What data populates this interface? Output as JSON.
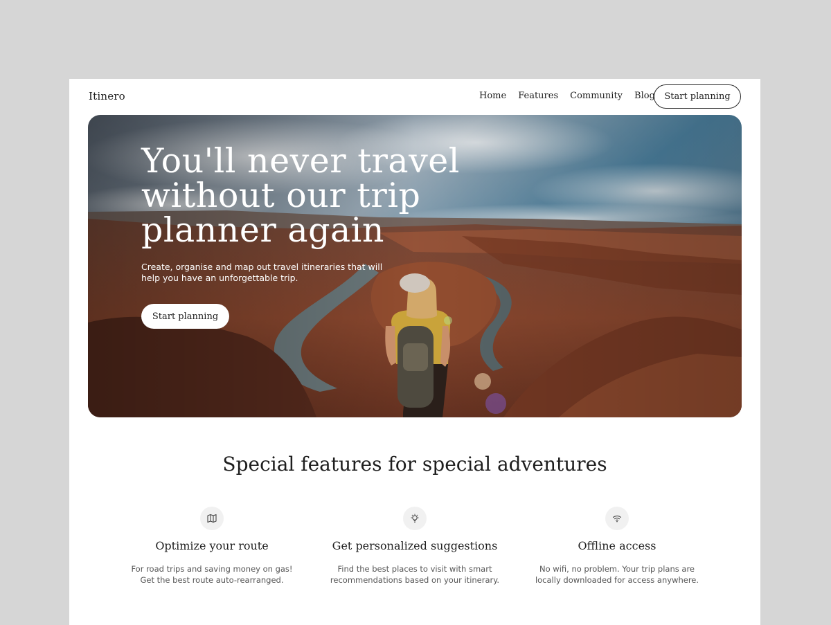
{
  "nav": {
    "logo": "Itinero",
    "links": [
      "Home",
      "Features",
      "Community",
      "Blog"
    ],
    "cta_label": "Start planning"
  },
  "hero": {
    "title_lines": [
      "You'll never travel",
      "without our trip",
      "planner again"
    ],
    "subtitle": "Create, organise and map out travel itineraries that will help you have an unforgettable trip.",
    "cta_label": "Start planning"
  },
  "features": {
    "heading": "Special features for special adventures",
    "items": [
      {
        "icon": "map-icon",
        "title": "Optimize your route",
        "description": "For road trips and saving money on gas! Get the best route auto-rearranged."
      },
      {
        "icon": "lightbulb-icon",
        "title": "Get personalized suggestions",
        "description": "Find the best places to visit with smart recommendations based on your itinerary."
      },
      {
        "icon": "wifi-icon",
        "title": "Offline access",
        "description": "No wifi, no problem. Your trip plans are locally downloaded for access anywhere."
      }
    ]
  },
  "colors": {
    "page_background": "#d6d6d6",
    "card_background": "#ffffff",
    "text": "#1e1e1e",
    "muted_text": "#555555",
    "canyon_rock": "#8a4a32",
    "river": "#5f6b6c"
  }
}
